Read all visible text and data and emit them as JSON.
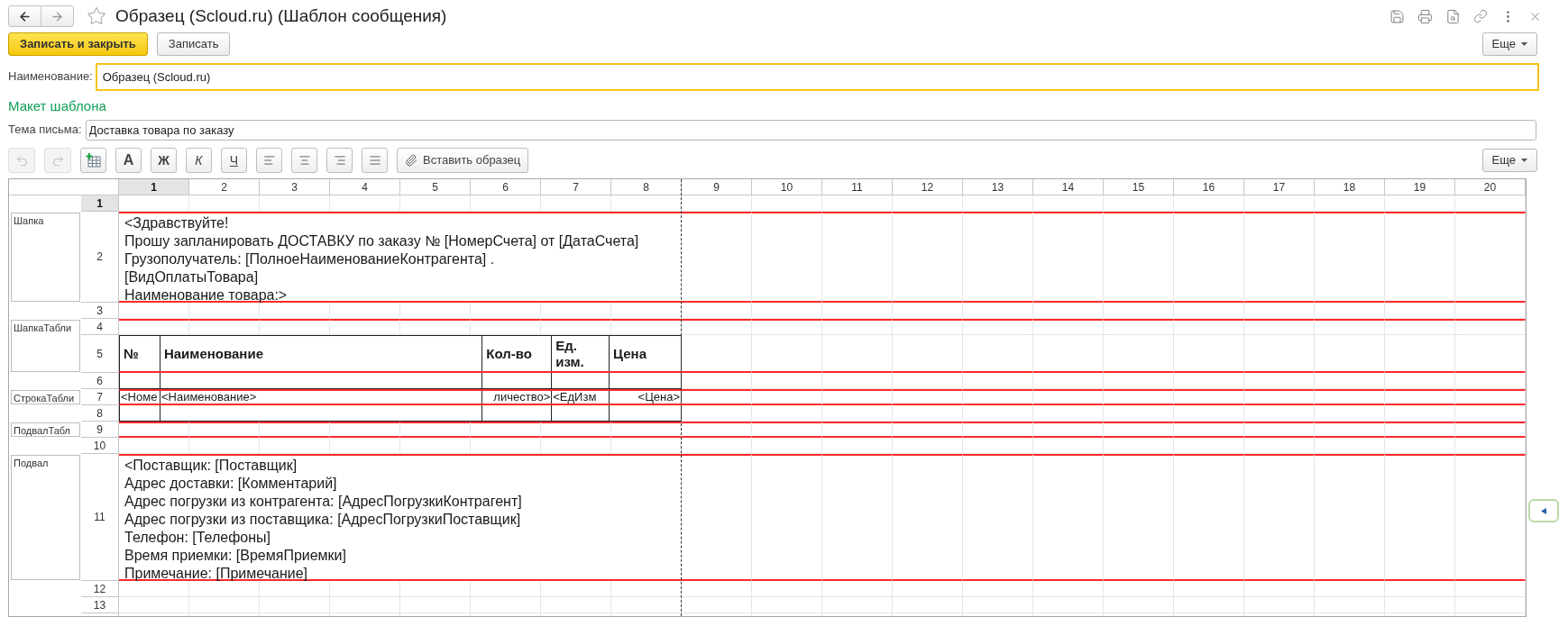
{
  "window": {
    "title": "Образец (Scloud.ru) (Шаблон сообщения)"
  },
  "command_bar": {
    "buttons": [
      {
        "label": "Записать и закрыть",
        "kind": "primary"
      },
      {
        "label": "Записать",
        "kind": "default"
      }
    ],
    "more": "Еще"
  },
  "name_field": {
    "label": "Наименование:",
    "value": "Образец (Scloud.ru)"
  },
  "section_title": "Макет шаблона",
  "subject_field": {
    "label": "Тема письма:",
    "value": "Доставка товара по заказу"
  },
  "toolbar": {
    "items": [
      {
        "kind": "undo",
        "disabled": true
      },
      {
        "kind": "redo",
        "disabled": true
      },
      {
        "kind": "insert_table",
        "disabled": false
      },
      {
        "kind": "letter",
        "label": "A",
        "disabled": false
      },
      {
        "kind": "letter",
        "label": "Ж",
        "disabled": false
      },
      {
        "kind": "letter",
        "label": "К",
        "disabled": false
      },
      {
        "kind": "letter",
        "label": "Ч",
        "disabled": false
      },
      {
        "kind": "align_left",
        "disabled": false
      },
      {
        "kind": "align_center",
        "disabled": false
      },
      {
        "kind": "align_right",
        "disabled": false
      },
      {
        "kind": "justify",
        "disabled": false
      },
      {
        "kind": "insert_sample",
        "label": "Вставить образец",
        "disabled": false
      }
    ],
    "more": "Еще"
  },
  "sheet": {
    "columns": [
      {
        "label": "1",
        "selected": true
      },
      {
        "label": "2",
        "selected": false
      },
      {
        "label": "3",
        "selected": false
      },
      {
        "label": "4",
        "selected": false
      },
      {
        "label": "5",
        "selected": false
      },
      {
        "label": "6",
        "selected": false
      },
      {
        "label": "7",
        "selected": false
      },
      {
        "label": "8",
        "selected": false
      },
      {
        "label": "9",
        "selected": false
      },
      {
        "label": "10",
        "selected": false
      },
      {
        "label": "11",
        "selected": false
      },
      {
        "label": "12",
        "selected": false
      },
      {
        "label": "13",
        "selected": false
      },
      {
        "label": "14",
        "selected": false
      },
      {
        "label": "15",
        "selected": false
      },
      {
        "label": "16",
        "selected": false
      },
      {
        "label": "17",
        "selected": false
      },
      {
        "label": "18",
        "selected": false
      },
      {
        "label": "19",
        "selected": false
      },
      {
        "label": "20",
        "selected": false
      }
    ],
    "sections": [
      {
        "rows": [
          {
            "number": "1",
            "selected": true,
            "kind": "empty"
          }
        ]
      },
      {
        "label": "Шапка",
        "rows": [
          {
            "number": "2",
            "selected": false,
            "kind": "text",
            "lines": [
              "<Здравствуйте!",
              "Прошу запланировать ДОСТАВКУ по заказу № [НомерСчета] от [ДатаСчета]",
              "Грузополучатель: [ПолноеНаименованиеКонтрагента] .",
              "[ВидОплатыТовара]",
              "Наименование товара:>"
            ]
          }
        ]
      },
      {
        "rows": [
          {
            "number": "3",
            "selected": false,
            "kind": "empty"
          }
        ]
      },
      {
        "label": "ШапкаТабли",
        "rows": [
          {
            "number": "4",
            "selected": false,
            "kind": "empty"
          },
          {
            "number": "5",
            "selected": false,
            "kind": "table_header",
            "cells": [
              "№",
              "Наименование",
              "Кол-во",
              "Ед. изм.",
              "Цена"
            ]
          }
        ]
      },
      {
        "rows": [
          {
            "number": "6",
            "selected": false,
            "kind": "table_blank"
          }
        ]
      },
      {
        "label": "СтрокаТабли",
        "rows": [
          {
            "number": "7",
            "selected": false,
            "kind": "table_row",
            "cells": [
              "<Номе",
              "<Наименование>",
              "личество>",
              "<ЕдИзм",
              "<Цена>"
            ]
          }
        ]
      },
      {
        "rows": [
          {
            "number": "8",
            "selected": false,
            "kind": "table_blank"
          }
        ]
      },
      {
        "label": "ПодвалТабл",
        "rows": [
          {
            "number": "9",
            "selected": false,
            "kind": "empty"
          }
        ]
      },
      {
        "rows": [
          {
            "number": "10",
            "selected": false,
            "kind": "empty"
          }
        ]
      },
      {
        "label": "Подвал",
        "rows": [
          {
            "number": "11",
            "selected": false,
            "kind": "text",
            "lines": [
              "<Поставщик: [Поставщик]",
              "Адрес доставки: [Комментарий]",
              "Адрес погрузки из контрагента: [АдресПогрузкиКонтрагент]",
              "Адрес погрузки из поставщика: [АдресПогрузкиПоставщик]",
              "Телефон: [Телефоны]",
              "Время приемки: [ВремяПриемки]",
              "Примечание: [Примечание]"
            ]
          }
        ]
      },
      {
        "rows": [
          {
            "number": "12",
            "selected": false,
            "kind": "empty"
          },
          {
            "number": "13",
            "selected": false,
            "kind": "empty"
          }
        ]
      }
    ]
  }
}
